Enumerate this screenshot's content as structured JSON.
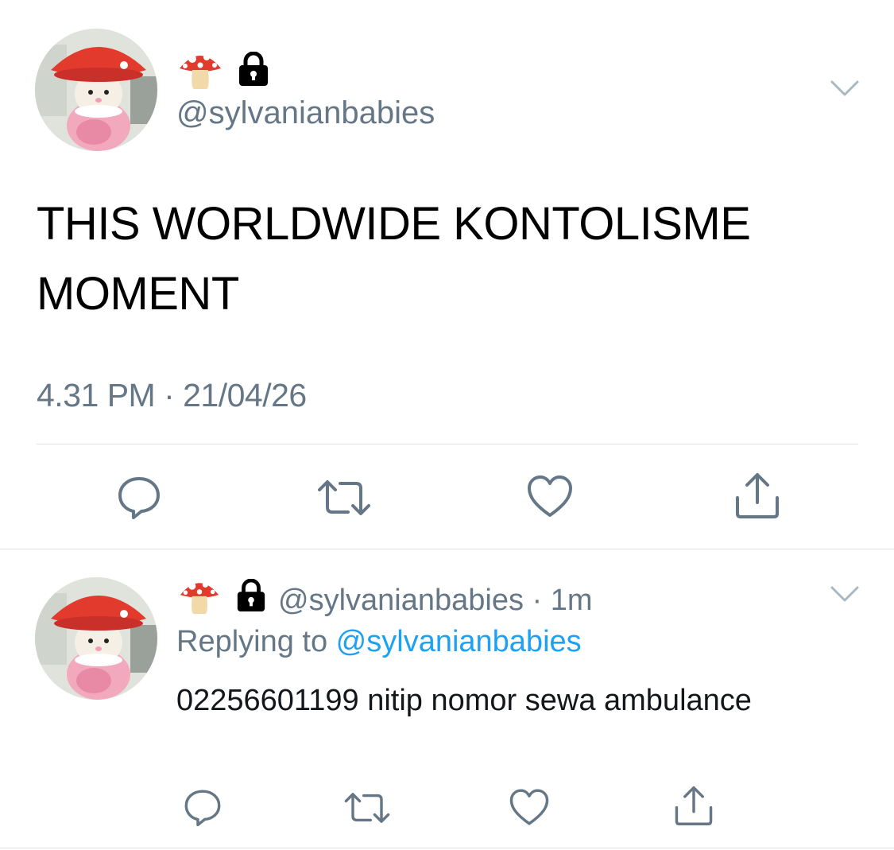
{
  "main_tweet": {
    "handle": "@sylvanianbabies",
    "text": "THIS WORLDWIDE KONTOLISME MOMENT",
    "timestamp": "4.31 PM · 21/04/26",
    "name_icons": [
      "mushroom-emoji",
      "lock-icon"
    ]
  },
  "reply_tweet": {
    "handle": "@sylvanianbabies",
    "separator": " · ",
    "time_ago": "1m",
    "replying_prefix": "Replying to ",
    "replying_mention": "@sylvanianbabies",
    "text": "02256601199 nitip nomor sewa ambulance",
    "name_icons": [
      "mushroom-emoji",
      "lock-icon"
    ]
  },
  "actions": [
    "reply-icon",
    "retweet-icon",
    "like-icon",
    "share-icon"
  ],
  "colors": {
    "text": "#000000",
    "secondary": "#657786",
    "link": "#1da1f2",
    "divider": "#dfe3e7",
    "icon": "#657786"
  }
}
